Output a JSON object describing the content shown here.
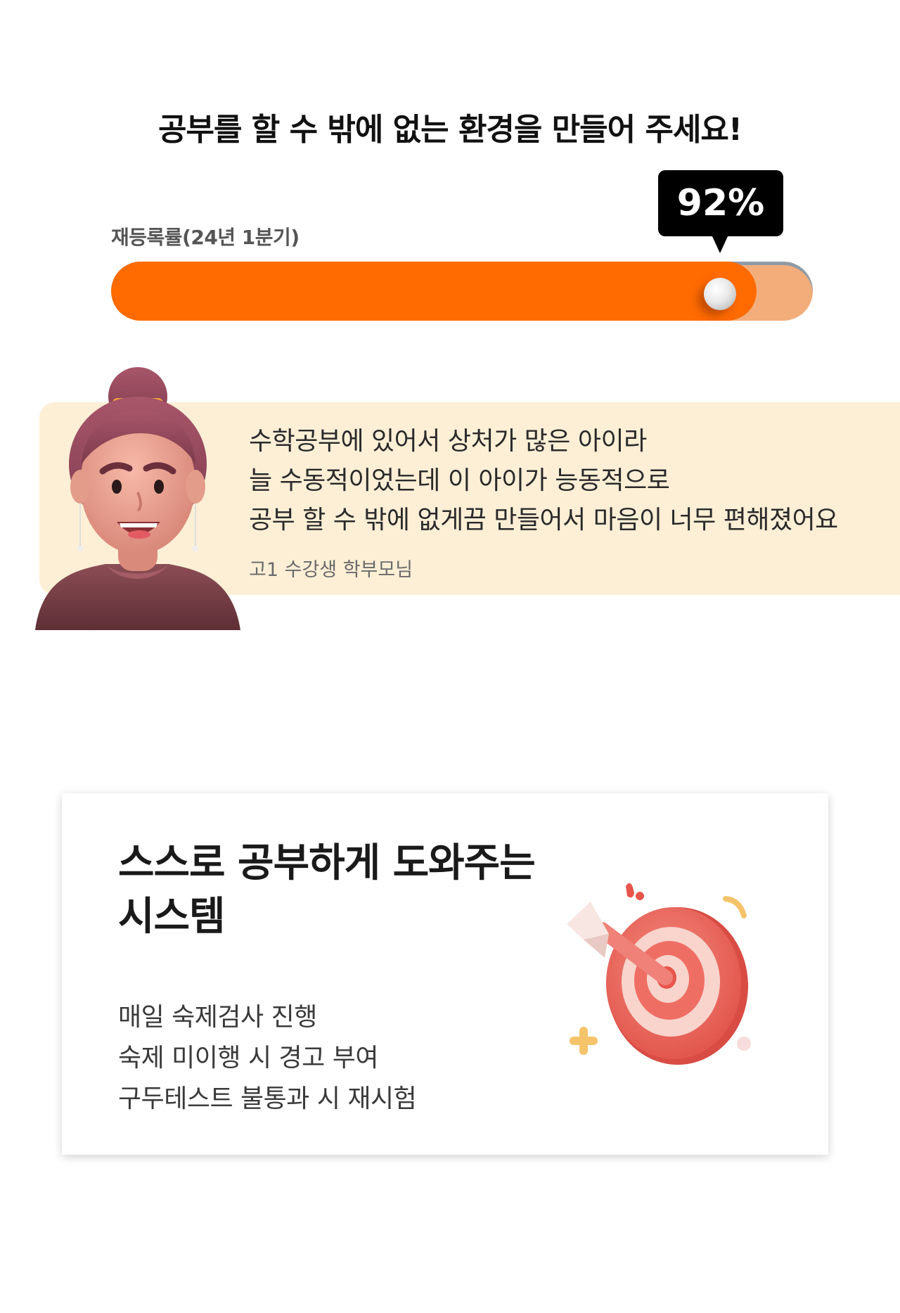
{
  "headline": "공부를 할 수 밖에 없는 환경을 만들어 주세요!",
  "stat": {
    "label": "재등록률(24년 1분기)",
    "value_text": "92%",
    "value": 0.92
  },
  "testimonial": {
    "lines": [
      "수학공부에 있어서 상처가 많은 아이라",
      "늘 수동적이었는데 이 아이가 능동적으로",
      "공부 할 수 밖에 없게끔 만들어서 마음이 너무 편해졌어요"
    ],
    "author": "고1 수강생 학부모님"
  },
  "feature": {
    "title_lines": [
      "스스로 공부하게 도와주는",
      "시스템"
    ],
    "items": [
      "매일 숙제검사 진행",
      "숙제 미이행 시 경고 부여",
      "구두테스트 불통과 시 재시험"
    ]
  },
  "colors": {
    "accent": "#ff6b00",
    "track": "#f2ad7b",
    "quote_bg": "#fdefd6"
  },
  "icons": {
    "avatar": "parent-avatar-illustration",
    "target": "target-arrow-illustration"
  }
}
